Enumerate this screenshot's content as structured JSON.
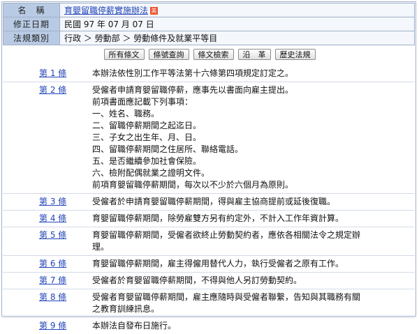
{
  "info": {
    "name_label": "名　稱",
    "law_name": "育嬰留職停薪實施辦法",
    "badge": "英",
    "date_label": "修正日期",
    "date_value": "民國 97 年 07 月 07 日",
    "category_label": "法規類別",
    "category_value": "行政 ＞ 勞動部 ＞ 勞動條件及就業平等目"
  },
  "buttons": [
    "所有條文",
    "條號查詢",
    "條文檢索",
    "沿　革",
    "歷史法規"
  ],
  "articles": [
    {
      "no": "第 1 條",
      "lines": [
        "本辦法依性別工作平等法第十六條第四項規定訂定之。"
      ]
    },
    {
      "no": "第 2 條",
      "lines": [
        "受僱者申請育嬰留職停薪，應事先以書面向雇主提出。",
        "前項書面應記載下列事項：",
        "一、姓名、職務。",
        "二、留職停薪期間之起迄日。",
        "三、子女之出生年、月、日。",
        "四、留職停薪期間之住居所、聯絡電話。",
        "五、是否繼續參加社會保險。",
        "六、檢附配偶就業之證明文件。",
        "前項育嬰留職停薪期間，每次以不少於六個月為原則。"
      ]
    },
    {
      "no": "第 3 條",
      "lines": [
        "受僱者於申請育嬰留職停薪期間，得與雇主協商提前或延後復職。"
      ]
    },
    {
      "no": "第 4 條",
      "lines": [
        "育嬰留職停薪期間，除勞雇雙方另有約定外，不計入工作年資計算。"
      ]
    },
    {
      "no": "第 5 條",
      "lines": [
        "育嬰留職停薪期間，受僱者欲終止勞動契約者，應依各相關法令之規定辦",
        "理。"
      ]
    },
    {
      "no": "第 6 條",
      "lines": [
        "育嬰留職停薪期間，雇主得僱用替代人力，執行受僱者之原有工作。"
      ]
    },
    {
      "no": "第 7 條",
      "lines": [
        "受僱者於育嬰留職停薪期間，不得與他人另訂勞動契約。"
      ]
    },
    {
      "no": "第 8 條",
      "lines": [
        "受僱者育嬰留職停薪期間，雇主應隨時與受僱者聯繫，告知與其職務有關",
        "之教育訓練訊息。"
      ]
    },
    {
      "no": "第 9 條",
      "lines": [
        "本辦法自發布日施行。"
      ]
    }
  ]
}
